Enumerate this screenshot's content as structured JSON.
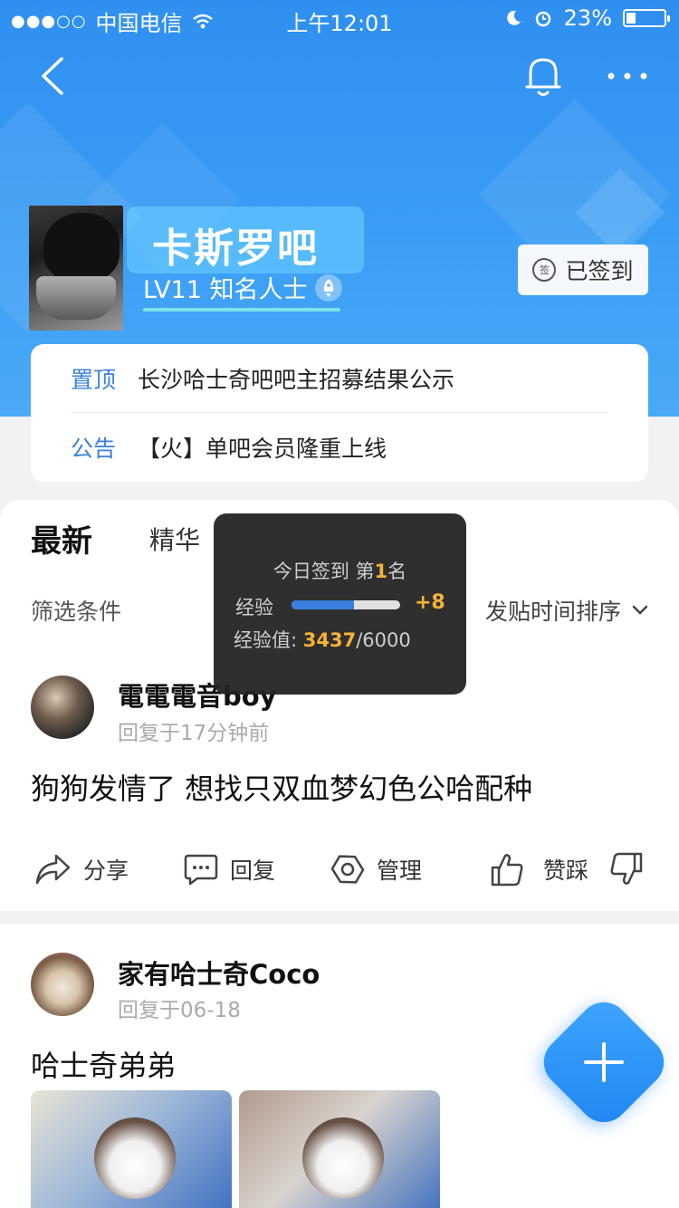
{
  "status_bar": {
    "signal_dots": "●●●○○",
    "carrier": "中国电信",
    "time": "上午12:01",
    "battery": "23%",
    "battery_level": 0.23
  },
  "forum": {
    "name": "卡斯罗吧",
    "level_text": "LV11 知名人士",
    "level_progress": 1.0,
    "checkin_label": "已签到",
    "checkin_icon_text": "签"
  },
  "notices": [
    {
      "tag": "置顶",
      "text": "长沙哈士奇吧吧主招募结果公示"
    },
    {
      "tag": "公告",
      "text": "【火】单吧会员隆重上线"
    }
  ],
  "tabs": {
    "newest": "最新",
    "best": "精华"
  },
  "filters": {
    "filter_label": "筛选条件",
    "sort_label": "发贴时间排序"
  },
  "tooltip": {
    "title_prefix": "今日签到 第",
    "rank": "1",
    "title_suffix": "名",
    "exp_label": "经验",
    "exp_gain": "+8",
    "exp_progress": 0.573,
    "value_label": "经验值: ",
    "value_current": "3437",
    "value_total": "/6000"
  },
  "posts": [
    {
      "user": "電電電音boy",
      "time": "回复于17分钟前",
      "title": "狗狗发情了 想找只双血梦幻色公哈配种"
    },
    {
      "user": "家有哈士奇Coco",
      "time": "回复于06-18",
      "title": "哈士奇弟弟"
    }
  ],
  "actions": {
    "share": "分享",
    "reply": "回复",
    "manage": "管理",
    "vote": "赞踩"
  },
  "colors": {
    "accent": "#2f8ff0",
    "highlight": "#f7b337"
  }
}
